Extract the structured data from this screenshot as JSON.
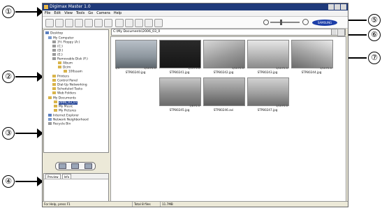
{
  "window": {
    "title": "Digimax Master 1.0"
  },
  "menu": [
    "File",
    "Edit",
    "View",
    "Tools",
    "Go",
    "Camera",
    "Help"
  ],
  "brand": {
    "logo_text": "SAMSUNG"
  },
  "address": {
    "path": "C:\\My Documents\\2006_03_0"
  },
  "tree": {
    "desktop": "Desktop",
    "my_computer": "My Computer",
    "floppy": "3½ Floppy (A:)",
    "drive_c": "(C:)",
    "drive_d": "(D:)",
    "drive_e": "(E:)",
    "removable": "Removable Disk (F:)",
    "album": "Album",
    "dcim": "Dcim",
    "dcim_sub": "100ssam",
    "printers": "Printers",
    "control_panel": "Control Panel",
    "dialup": "Dial-Up Networking",
    "scheduled": "Scheduled Tasks",
    "web_folders": "Web Folders",
    "my_documents": "My Documents",
    "doc_folder": "2006_03_07",
    "my_music": "My Music",
    "my_pictures": "My Pictures",
    "internet_explorer": "Internet Explorer",
    "network": "Network Neighborhood",
    "recycle": "Recycle Bin"
  },
  "info_tabs": [
    "Preview",
    "Info"
  ],
  "thumbnails": [
    {
      "filename": "STP80240.jpg",
      "meta_left": "1/3",
      "meta_right": "1/10 F2.5"
    },
    {
      "filename": "STP80241.jpg",
      "meta_left": "",
      "meta_right": "1/15 F3.4"
    },
    {
      "filename": "STP80242.jpg",
      "meta_left": "",
      "meta_right": "1/10 F2.5"
    },
    {
      "filename": "STP80243.jpg",
      "meta_left": "",
      "meta_right": "1/10 F2.5"
    },
    {
      "filename": "STP80244.jpg",
      "meta_left": "",
      "meta_right": "1/10 F2.5"
    },
    {
      "filename": "STP80245.jpg",
      "meta_left": "",
      "meta_right": "1/6 F2.5"
    },
    {
      "filename": "STP80246.avi",
      "meta_left": "",
      "meta_right": ""
    },
    {
      "filename": "STP80247.jpg",
      "meta_left": "",
      "meta_right": "1/10 F2.5"
    }
  ],
  "status": {
    "help": "For Help, press F1",
    "total": "Total 8 files",
    "size": "11.7MB"
  },
  "callouts": [
    "①",
    "②",
    "③",
    "④",
    "⑤",
    "⑥",
    "⑦"
  ]
}
